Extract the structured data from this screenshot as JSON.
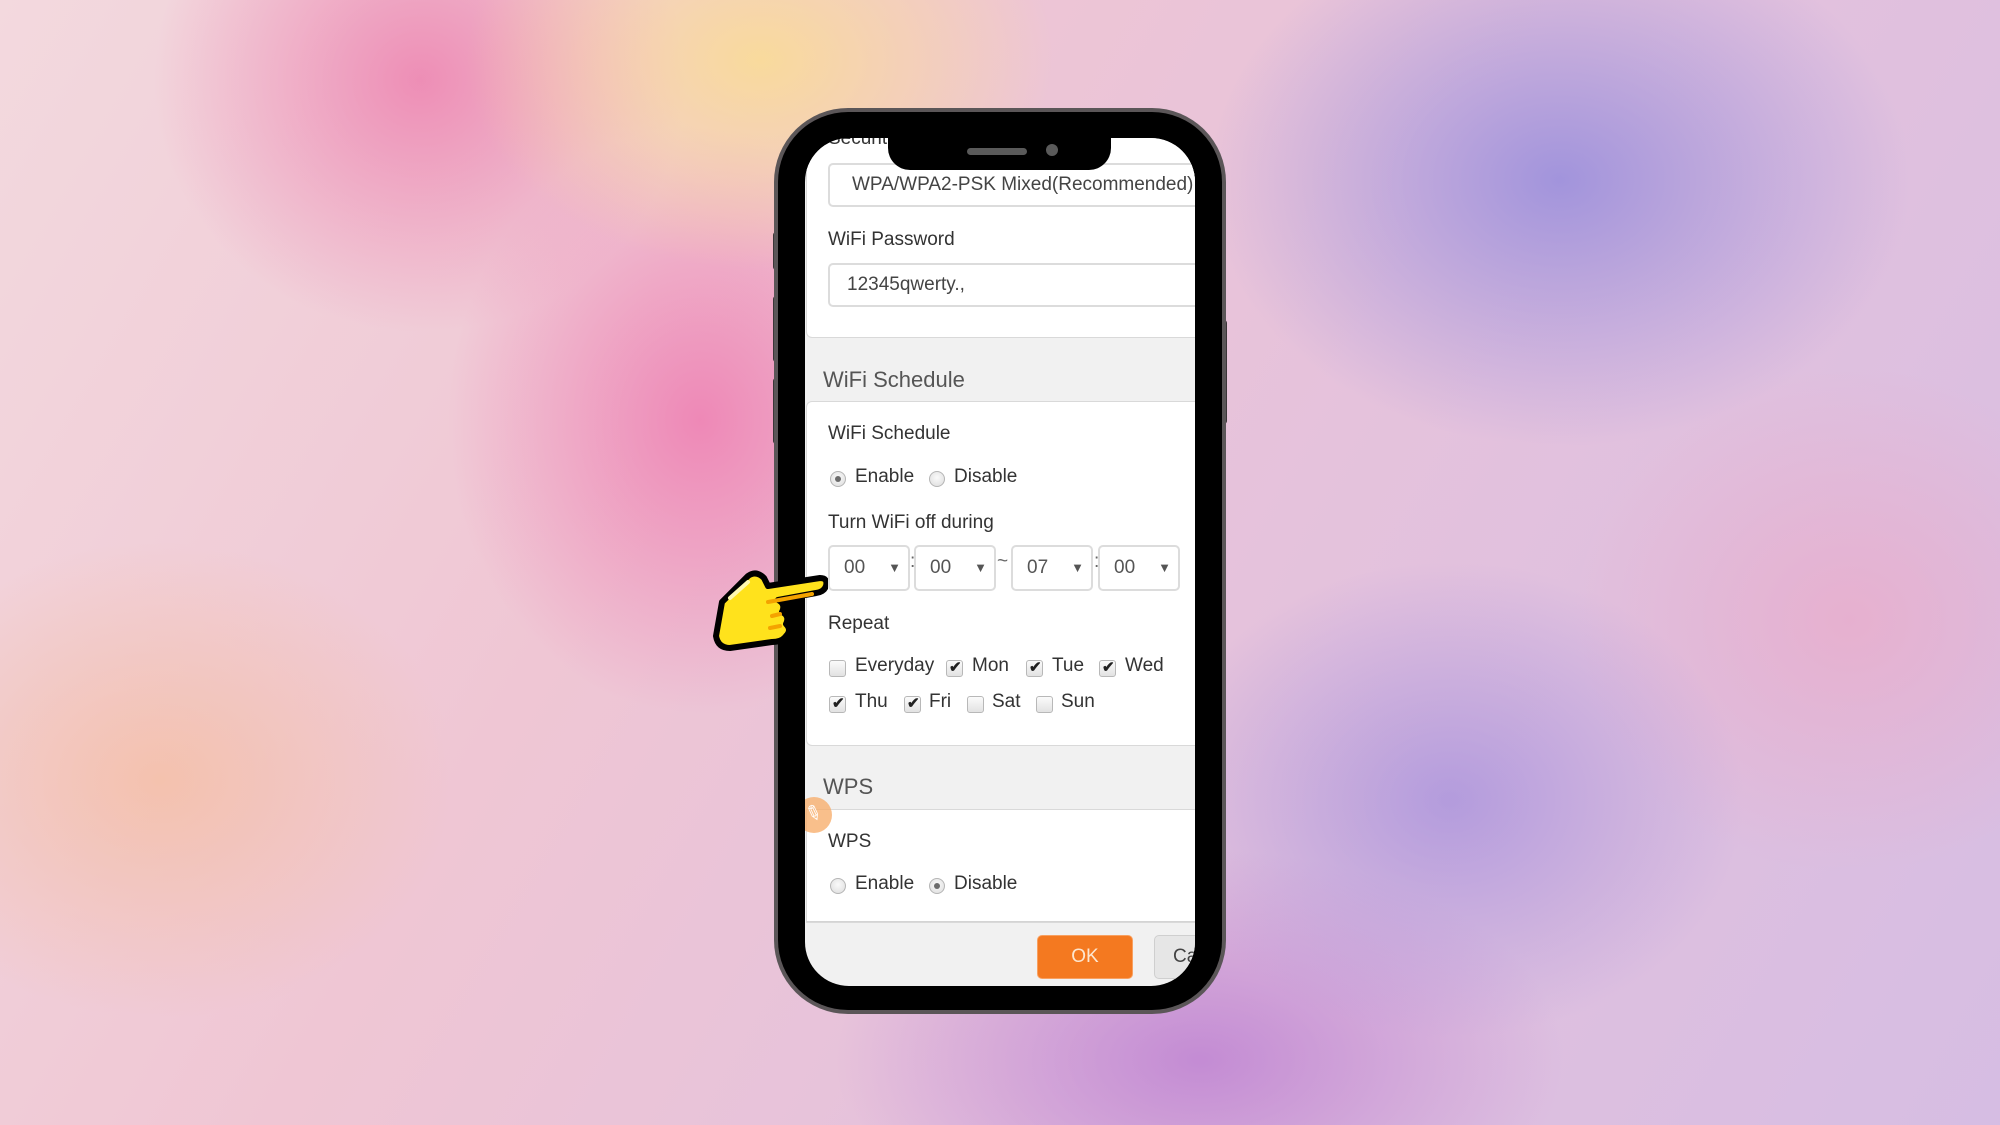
{
  "form": {
    "security": {
      "label_partial": "Securit",
      "value": "WPA/WPA2-PSK Mixed(Recommended)"
    },
    "wifi_password": {
      "label": "WiFi Password",
      "value": "12345qwerty.,"
    },
    "wifi_schedule_section": {
      "title": "WiFi Schedule",
      "schedule_label": "WiFi Schedule",
      "options": [
        {
          "label": "Enable",
          "selected": true
        },
        {
          "label": "Disable",
          "selected": false
        }
      ],
      "turn_off_label": "Turn WiFi off during",
      "time": {
        "start_hour": "00",
        "start_minute": "00",
        "end_hour": "07",
        "end_minute": "00",
        "colon": ":",
        "range_separator": "~",
        "dropdown_glyph": "▼"
      },
      "repeat_label": "Repeat",
      "days": [
        {
          "label": "Everyday",
          "checked": false
        },
        {
          "label": "Mon",
          "checked": true
        },
        {
          "label": "Tue",
          "checked": true
        },
        {
          "label": "Wed",
          "checked": true
        },
        {
          "label": "Thu",
          "checked": true
        },
        {
          "label": "Fri",
          "checked": true
        },
        {
          "label": "Sat",
          "checked": false
        },
        {
          "label": "Sun",
          "checked": false
        }
      ],
      "check_glyph": "✔"
    },
    "wps_section": {
      "title": "WPS",
      "wps_label": "WPS",
      "options": [
        {
          "label": "Enable",
          "selected": false
        },
        {
          "label": "Disable",
          "selected": true
        }
      ]
    }
  },
  "footer": {
    "ok_label": "OK",
    "cancel_label": "Cancel"
  },
  "overlay": {
    "pointer_icon": "pointing-hand-icon",
    "badge_icon": "edit-pencil-icon"
  },
  "colors": {
    "accent": "#f47920",
    "card_bg": "#ffffff",
    "page_bg": "#f1f1f1"
  }
}
